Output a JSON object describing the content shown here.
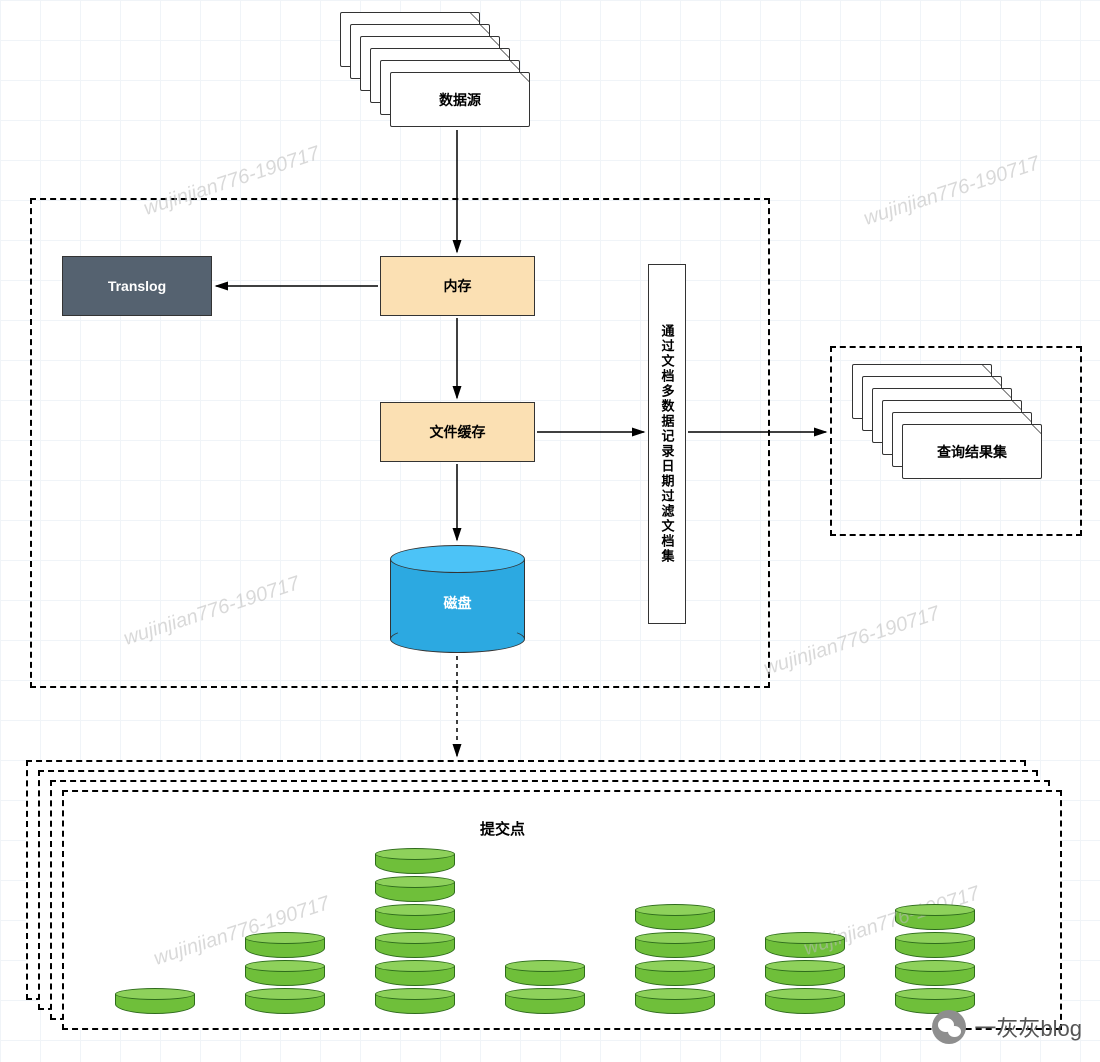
{
  "nodes": {
    "data_source": "数据源",
    "translog": "Translog",
    "memory": "内存",
    "file_cache": "文件缓存",
    "disk": "磁盘",
    "filter_box": "通过文档多数据记录日期过滤文档集",
    "result_set": "查询结果集",
    "commit_point": "提交点"
  },
  "segment_columns": [
    1,
    3,
    6,
    2,
    4,
    3,
    4
  ],
  "watermark": "wujinjian776-190717",
  "blog_label": "一灰灰blog"
}
